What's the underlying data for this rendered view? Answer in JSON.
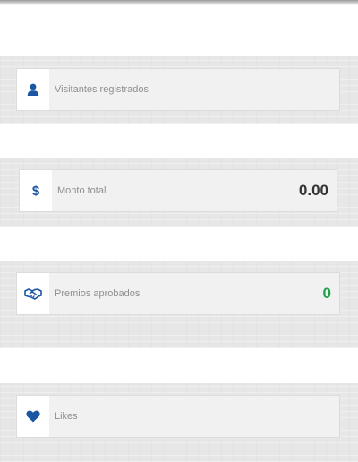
{
  "accent_color": "#1a56a3",
  "cards": [
    {
      "label": "Visitantes registrados",
      "value": "",
      "icon": "user-icon"
    },
    {
      "label": "Monto total",
      "value": "0.00",
      "icon": "dollar-icon",
      "value_color": "#333333"
    },
    {
      "label": "Premios aprobados",
      "value": "0",
      "icon": "handshake-icon",
      "value_color": "#1fa34a"
    },
    {
      "label": "Likes",
      "value": "",
      "icon": "heart-icon"
    }
  ]
}
